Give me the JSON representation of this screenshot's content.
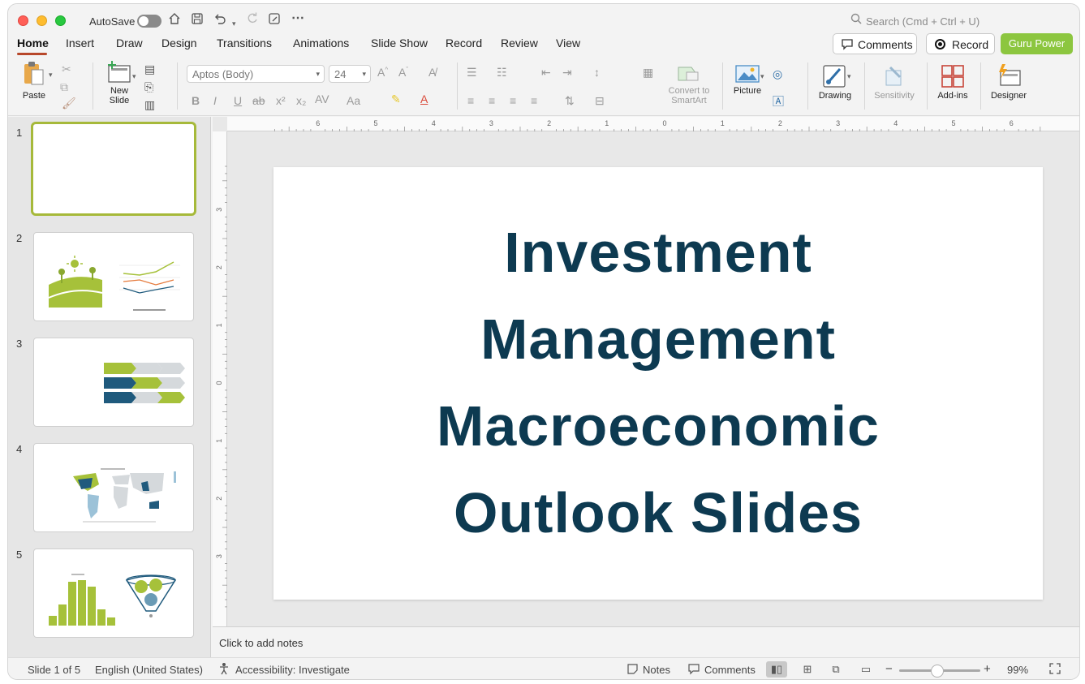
{
  "titlebar": {
    "autosave_label": "AutoSave",
    "search_placeholder": "Search (Cmd + Ctrl + U)"
  },
  "tabs": [
    "Home",
    "Insert",
    "Draw",
    "Design",
    "Transitions",
    "Animations",
    "Slide Show",
    "Record",
    "Review",
    "View"
  ],
  "header_buttons": {
    "comments": "Comments",
    "record": "Record",
    "guru": "Guru Power"
  },
  "ribbon": {
    "paste": "Paste",
    "new_slide_line1": "New",
    "new_slide_line2": "Slide",
    "font_name": "Aptos (Body)",
    "font_size": "24",
    "convert_line1": "Convert to",
    "convert_line2": "SmartArt",
    "picture": "Picture",
    "drawing": "Drawing",
    "sensitivity": "Sensitivity",
    "addins": "Add-ins",
    "designer": "Designer"
  },
  "slides": [
    {
      "number": "1"
    },
    {
      "number": "2"
    },
    {
      "number": "3"
    },
    {
      "number": "4"
    },
    {
      "number": "5"
    }
  ],
  "slide": {
    "title_lines": [
      "Investment",
      "Management",
      "Macroeconomic",
      "Outlook Slides"
    ]
  },
  "ruler": {
    "h_labels": [
      "6",
      "5",
      "4",
      "3",
      "2",
      "1",
      "0",
      "1",
      "2",
      "3",
      "4",
      "5",
      "6"
    ],
    "v_labels": [
      "3",
      "2",
      "1",
      "0",
      "1",
      "2",
      "3"
    ]
  },
  "notes": {
    "placeholder": "Click to add notes"
  },
  "status": {
    "slide_count": "Slide 1 of 5",
    "language": "English (United States)",
    "accessibility": "Accessibility: Investigate",
    "notes": "Notes",
    "comments": "Comments",
    "zoom": "99%"
  },
  "colors": {
    "accent": "#b7472a",
    "title_text": "#0d3a51",
    "green": "#a6c13a",
    "navy": "#1f5a7d",
    "guru": "#8cc63f"
  },
  "icons": [
    "search-icon",
    "home-icon",
    "save-icon",
    "undo-icon",
    "redo-icon",
    "more-icon",
    "comment-icon",
    "record-icon"
  ]
}
